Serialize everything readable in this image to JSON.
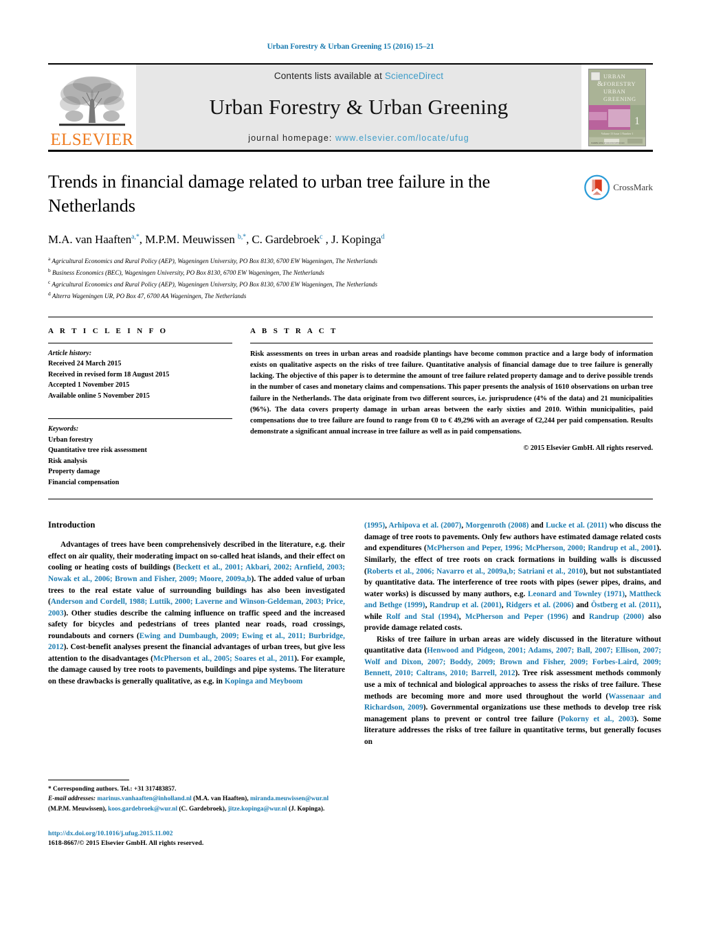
{
  "running_head": "Urban Forestry & Urban Greening 15 (2016) 15–21",
  "masthead": {
    "publisher_name": "ELSEVIER",
    "contents_prefix": "Contents lists available at ",
    "sciencedirect": "ScienceDirect",
    "journal_title": "Urban Forestry & Urban Greening",
    "homepage_prefix": "journal homepage: ",
    "homepage_url": "www.elsevier.com/locate/ufug",
    "cover": {
      "line1": "URBAN",
      "line2": "FORESTRY",
      "line3": "& URBAN",
      "line4": "GREENING",
      "issue_number": "1",
      "volume_caption": "Volume 15 · Issue 1 · Number 1"
    },
    "colors": {
      "link_blue": "#3e9cc8",
      "elsevier_orange": "#ef7c21",
      "band_grey": "#e7e7e7"
    }
  },
  "article": {
    "title": "Trends in financial damage related to urban tree failure in the Netherlands",
    "authors_html": "M.A. van Haaften<sup>a,*</sup>, M.P.M. Meuwissen <sup>b,*</sup>, C. Gardebroek<sup>c</sup> , J. Kopinga<sup>d</sup>",
    "affiliations": [
      {
        "mark": "a",
        "text": "Agricultural Economics and Rural Policy (AEP), Wageningen University, PO Box 8130, 6700 EW Wageningen, The Netherlands"
      },
      {
        "mark": "b",
        "text": "Business Economics (BEC), Wageningen University, PO Box 8130, 6700 EW Wageningen, The Netherlands"
      },
      {
        "mark": "c",
        "text": "Agricultural Economics and Rural Policy (AEP), Wageningen University, PO Box 8130, 6700 EW Wageningen, The Netherlands"
      },
      {
        "mark": "d",
        "text": "Alterra Wageningen UR, PO Box 47, 6700 AA Wageningen, The Netherlands"
      }
    ],
    "crossmark_label": "CrossMark"
  },
  "article_info": {
    "heading": "A R T I C L E    I N F O",
    "history_label": "Article history:",
    "history": [
      "Received 24 March 2015",
      "Received in revised form 18 August 2015",
      "Accepted 1 November 2015",
      "Available online 5 November 2015"
    ],
    "keywords_label": "Keywords:",
    "keywords": [
      "Urban forestry",
      "Quantitative tree risk assessment",
      "Risk analysis",
      "Property damage",
      "Financial compensation"
    ]
  },
  "abstract": {
    "heading": "A B S T R A C T",
    "text": "Risk assessments on trees in urban areas and roadside plantings have become common practice and a large body of information exists on qualitative aspects on the risks of tree failure. Quantitative analysis of financial damage due to tree failure is generally lacking. The objective of this paper is to determine the amount of tree failure related property damage and to derive possible trends in the number of cases and monetary claims and compensations. This paper presents the analysis of 1610 observations on urban tree failure in the Netherlands. The data originate from two different sources, i.e. jurisprudence (4% of the data) and 21 municipalities (96%). The data covers property damage in urban areas between the early sixties and 2010. Within municipalities, paid compensations due to tree failure are found to range from €0 to € 49,296 with an average of €2,244 per paid compensation. Results demonstrate a significant annual increase in tree failure as well as in paid compensations.",
    "copyright": "© 2015 Elsevier GmbH. All rights reserved."
  },
  "introduction": {
    "heading": "Introduction",
    "left_paragraphs": [
      {
        "segments": [
          {
            "t": "Advantages of trees have been comprehensively described in the literature, e.g. their effect on air quality, their moderating impact on so-called heat islands, and their effect on cooling or heating costs of buildings (",
            "link": false
          },
          {
            "t": "Beckett et al., 2001; Akbari, 2002; Arnfield, 2003; Nowak et al., 2006; Brown and Fisher, 2009; Moore, 2009a,b",
            "link": true
          },
          {
            "t": "). The added value of urban trees to the real estate value of surrounding buildings has also been investigated (",
            "link": false
          },
          {
            "t": "Anderson and Cordell, 1988; Luttik, 2000; Laverne and Winson-Geldeman, 2003; Price, 2003",
            "link": true
          },
          {
            "t": "). Other studies describe the calming influence on traffic speed and the increased safety for bicycles and pedestrians of trees planted near roads, road crossings, roundabouts and corners (",
            "link": false
          },
          {
            "t": "Ewing and Dumbaugh, 2009; Ewing et al., 2011; Burbridge, 2012",
            "link": true
          },
          {
            "t": "). Cost-benefit analyses present the financial advantages of urban trees, but give less attention to the disadvantages (",
            "link": false
          },
          {
            "t": "McPherson et al., 2005; Soares et al., 2011",
            "link": true
          },
          {
            "t": "). For example, the damage caused by tree roots to pavements, buildings and pipe systems. The literature on these drawbacks is generally qualitative, as e.g. in ",
            "link": false
          },
          {
            "t": "Kopinga and Meyboom",
            "link": true
          }
        ]
      }
    ],
    "right_paragraphs": [
      {
        "indent": false,
        "segments": [
          {
            "t": "(1995)",
            "link": true
          },
          {
            "t": ", ",
            "link": false
          },
          {
            "t": "Arhipova et al. (2007)",
            "link": true
          },
          {
            "t": ", ",
            "link": false
          },
          {
            "t": "Morgenroth (2008)",
            "link": true
          },
          {
            "t": " and ",
            "link": false
          },
          {
            "t": "Lucke et al. (2011)",
            "link": true
          },
          {
            "t": " who discuss the damage of tree roots to pavements. Only few authors have estimated damage related costs and expenditures (",
            "link": false
          },
          {
            "t": "McPherson and Peper, 1996; McPherson, 2000; Randrup et al., 2001",
            "link": true
          },
          {
            "t": "). Similarly, the effect of tree roots on crack formations in building walls is discussed (",
            "link": false
          },
          {
            "t": "Roberts et al., 2006; Navarro et al., 2009a,b; Satriani et al., 2010",
            "link": true
          },
          {
            "t": "), but not substantiated by quantitative data. The interference of tree roots with pipes (sewer pipes, drains, and water works) is discussed by many authors, e.g. ",
            "link": false
          },
          {
            "t": "Leonard and Townley (1971)",
            "link": true
          },
          {
            "t": ", ",
            "link": false
          },
          {
            "t": "Mattheck and Bethge (1999)",
            "link": true
          },
          {
            "t": ", ",
            "link": false
          },
          {
            "t": "Randrup et al. (2001)",
            "link": true
          },
          {
            "t": ", ",
            "link": false
          },
          {
            "t": "Ridgers et al. (2006)",
            "link": true
          },
          {
            "t": " and ",
            "link": false
          },
          {
            "t": "Östberg et al. (2011)",
            "link": true
          },
          {
            "t": ", while ",
            "link": false
          },
          {
            "t": "Rolf and Stal (1994)",
            "link": true
          },
          {
            "t": ", ",
            "link": false
          },
          {
            "t": "McPherson and Peper (1996)",
            "link": true
          },
          {
            "t": " and ",
            "link": false
          },
          {
            "t": "Randrup (2000)",
            "link": true
          },
          {
            "t": " also provide damage related costs.",
            "link": false
          }
        ]
      },
      {
        "indent": true,
        "segments": [
          {
            "t": "Risks of tree failure in urban areas are widely discussed in the literature without quantitative data (",
            "link": false
          },
          {
            "t": "Henwood and Pidgeon, 2001; Adams, 2007; Ball, 2007; Ellison, 2007; Wolf and Dixon, 2007; Boddy, 2009; Brown and Fisher, 2009; Forbes-Laird, 2009; Bennett, 2010; Caltrans, 2010; Barrell, 2012",
            "link": true
          },
          {
            "t": "). Tree risk assessment methods commonly use a mix of technical and biological approaches to assess the risks of tree failure. These methods are becoming more and more used throughout the world (",
            "link": false
          },
          {
            "t": "Wassenaar and Richardson, 2009",
            "link": true
          },
          {
            "t": "). Governmental organizations use these methods to develop tree risk management plans to prevent or control tree failure (",
            "link": false
          },
          {
            "t": "Pokorny et al., 2003",
            "link": true
          },
          {
            "t": "). Some literature addresses the risks of tree failure in quantitative terms, but generally focuses on",
            "link": false
          }
        ]
      }
    ]
  },
  "footnotes": {
    "corresponding": "* Corresponding authors. Tel.: +31 317483857.",
    "email_label": "E-mail addresses:",
    "emails": [
      {
        "address": "marinus.vanhaaften@inholland.nl",
        "owner": " (M.A. van Haaften), "
      },
      {
        "address": "miranda.meuwissen@wur.nl",
        "owner": " (M.P.M. Meuwissen), "
      },
      {
        "address": "koos.gardebroek@wur.nl",
        "owner": " (C. Gardebroek), "
      },
      {
        "address": "jitze.kopinga@wur.nl",
        "owner": " (J. Kopinga)."
      }
    ],
    "doi": "http://dx.doi.org/10.1016/j.ufug.2015.11.002",
    "issn_line": "1618-8667/© 2015 Elsevier GmbH. All rights reserved."
  }
}
